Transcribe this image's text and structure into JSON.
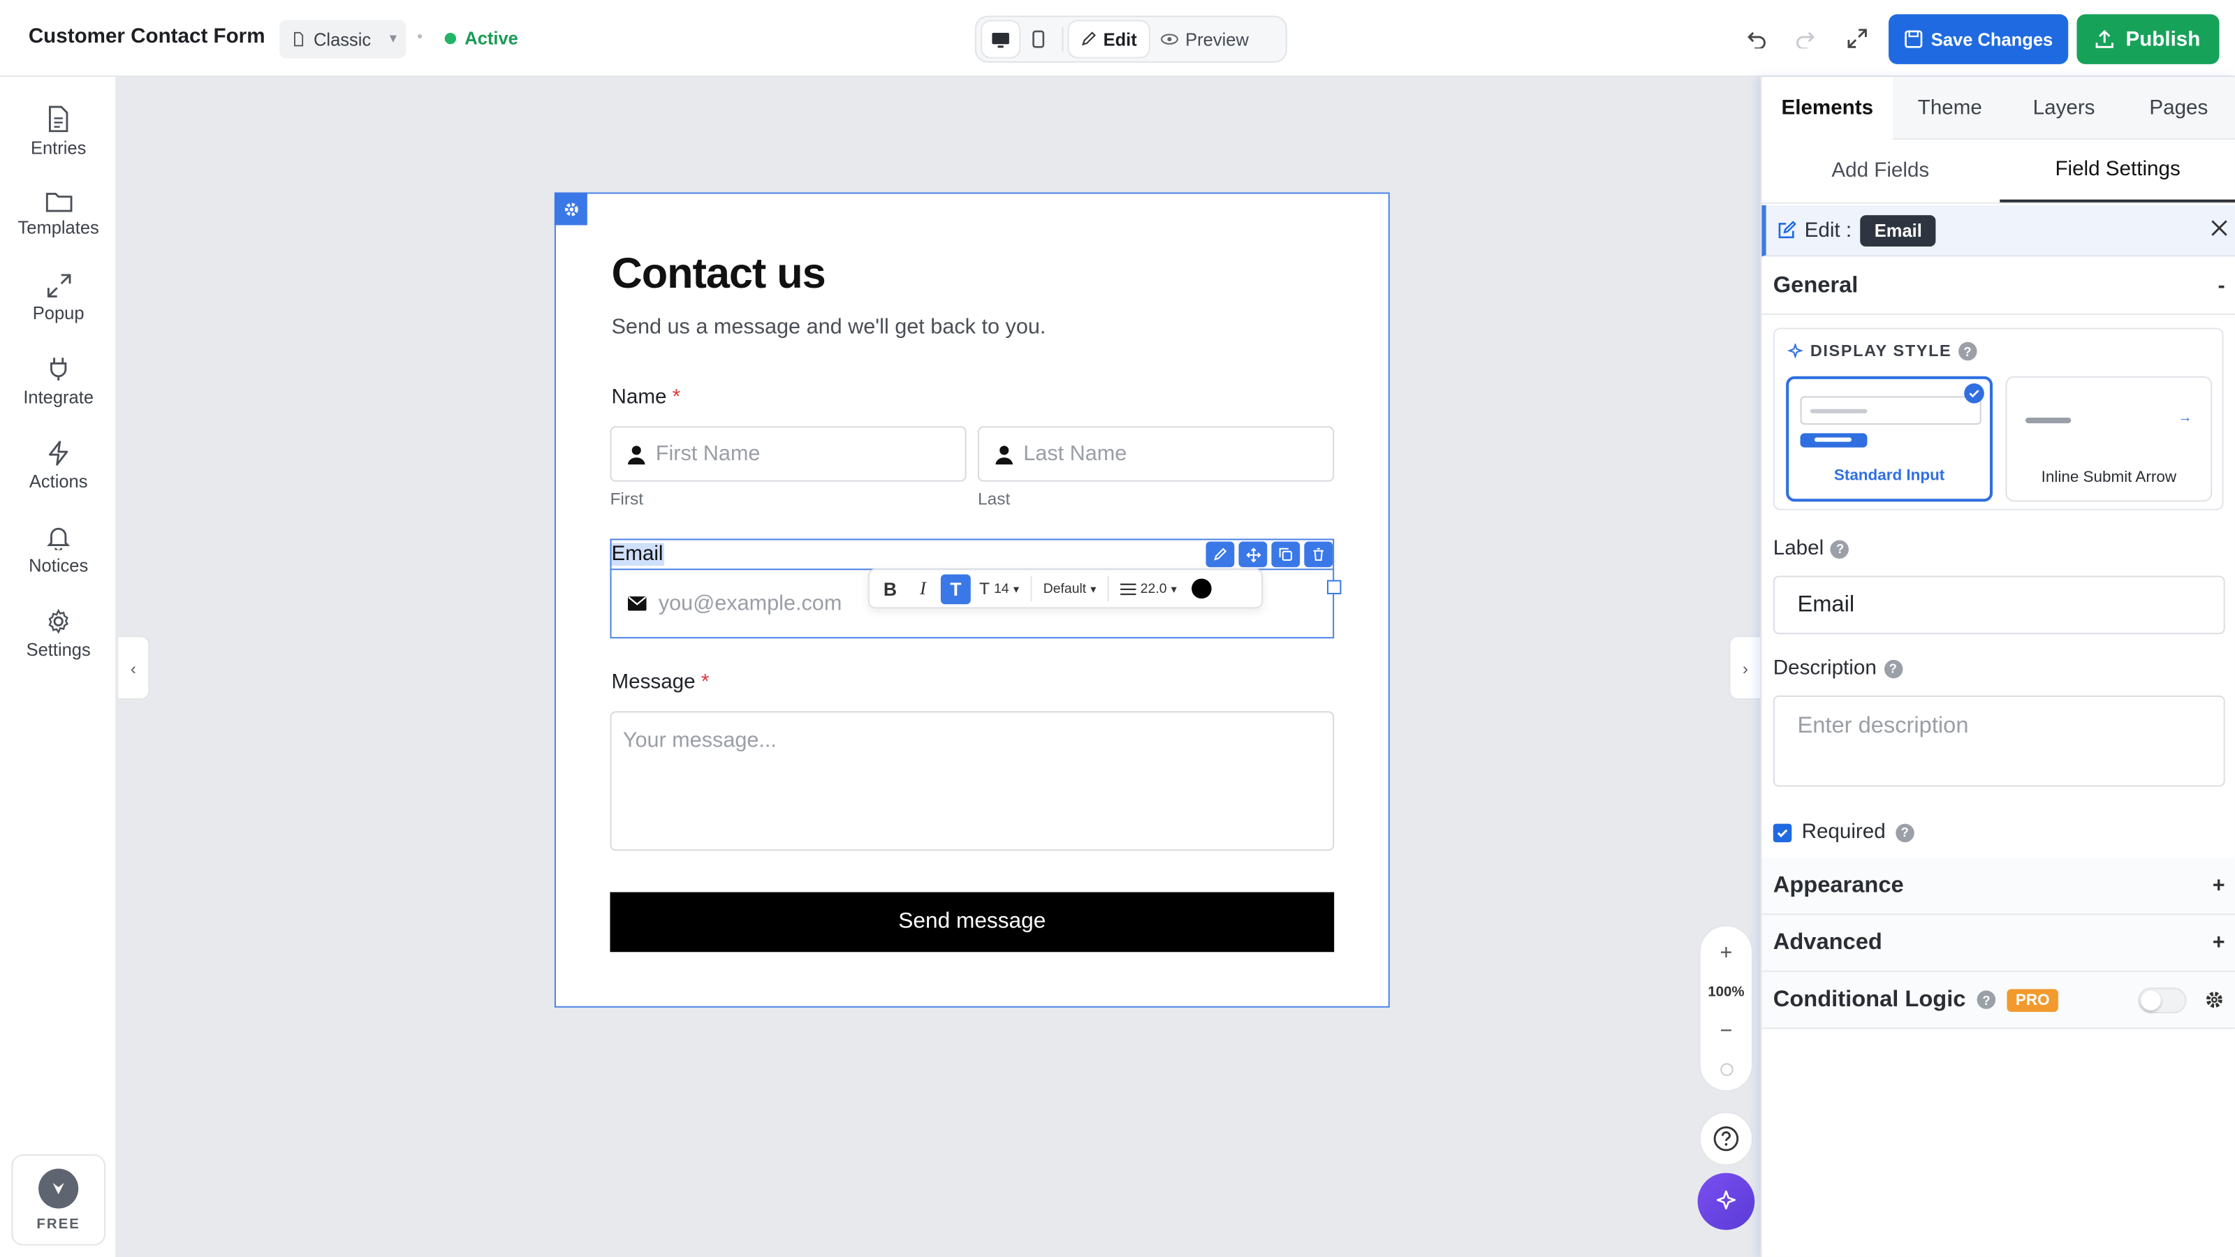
{
  "app": {
    "form_title": "Customer Contact Form",
    "layout_select": "Classic",
    "status": "Active",
    "modes": {
      "edit": "Edit",
      "preview": "Preview"
    },
    "save_label": "Save Changes",
    "publish_label": "Publish"
  },
  "sidebar": {
    "items": [
      {
        "label": "Entries",
        "icon": "document-icon"
      },
      {
        "label": "Templates",
        "icon": "folder-icon"
      },
      {
        "label": "Popup",
        "icon": "expand-icon"
      },
      {
        "label": "Integrate",
        "icon": "plug-icon"
      },
      {
        "label": "Actions",
        "icon": "lightning-icon"
      },
      {
        "label": "Notices",
        "icon": "bell-icon"
      },
      {
        "label": "Settings",
        "icon": "gear-icon"
      }
    ],
    "plan_label": "FREE"
  },
  "form": {
    "title": "Contact us",
    "subtitle": "Send us a message and we'll get back to you.",
    "name_label": "Name",
    "required_mark": "*",
    "first_placeholder": "First Name",
    "last_placeholder": "Last Name",
    "first_help": "First",
    "last_help": "Last",
    "email_label": "Email",
    "email_placeholder": "you@example.com",
    "message_label": "Message",
    "message_placeholder": "Your message...",
    "submit_label": "Send message"
  },
  "rte": {
    "bold": "B",
    "italic": "I",
    "text": "T",
    "font_size": "14",
    "font_family": "Default",
    "line_height": "22.0",
    "color": "#000000"
  },
  "zoom": {
    "level": "100%"
  },
  "panel": {
    "tabs": [
      "Elements",
      "Theme",
      "Layers",
      "Pages"
    ],
    "subtabs": [
      "Add Fields",
      "Field Settings"
    ],
    "edit_prefix": "Edit :",
    "edit_field": "Email",
    "general": "General",
    "general_toggle": "-",
    "display_style_title": "DISPLAY STYLE",
    "display_options": [
      "Standard Input",
      "Inline Submit Arrow"
    ],
    "label_title": "Label",
    "label_value": "Email",
    "description_title": "Description",
    "description_placeholder": "Enter description",
    "required_label": "Required",
    "appearance": "Appearance",
    "advanced": "Advanced",
    "expand_symbol": "+",
    "conditional_logic": "Conditional Logic",
    "pro_badge": "PRO"
  },
  "colors": {
    "accent": "#1f6ae0",
    "publish": "#17a25a",
    "active_status": "#20b466",
    "selection": "#4d83e6",
    "pro": "#f29a2e"
  }
}
